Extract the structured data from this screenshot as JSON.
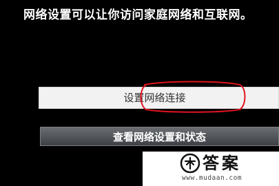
{
  "header": {
    "text": "网络设置可以让你访问家庭网络和互联网。"
  },
  "menu": {
    "setup_label": "设置网络连接",
    "status_label": "查看网络设置和状态"
  },
  "watermark": {
    "brand": "答案",
    "url": "www.mudaan.com"
  },
  "colors": {
    "background": "#000000",
    "highlight_ring": "#e0141e",
    "selected_button_bg": "#f2f2f2",
    "button_bg": "#55585c"
  }
}
